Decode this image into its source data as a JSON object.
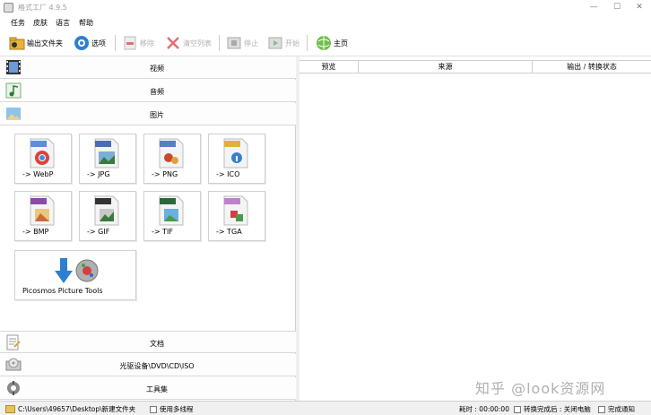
{
  "window": {
    "title": "格式工厂 4.9.5",
    "minimize": "—",
    "maximize": "☐",
    "close": "✕"
  },
  "menu": [
    "任务",
    "皮肤",
    "语言",
    "帮助"
  ],
  "toolbar": {
    "output_folder": "输出文件夹",
    "options": "选项",
    "remove": "移除",
    "clear_list": "清空列表",
    "stop": "停止",
    "start": "开始",
    "home": "主页"
  },
  "categories": {
    "video": "视频",
    "audio": "音频",
    "picture": "图片",
    "document": "文档",
    "optical": "光驱设备\\DVD\\CD\\ISO",
    "tools": "工具集"
  },
  "tiles": [
    {
      "badge": "WebP",
      "label": "-> WebP",
      "color": "#5b8fd6"
    },
    {
      "badge": "JPG",
      "label": "-> JPG",
      "color": "#4a6fb0"
    },
    {
      "badge": "PNG",
      "label": "-> PNG",
      "color": "#5a7fc0"
    },
    {
      "badge": "ICO",
      "label": "-> ICO",
      "color": "#e0b040"
    },
    {
      "badge": "BMP",
      "label": "-> BMP",
      "color": "#8a4aa8"
    },
    {
      "badge": "GIF",
      "label": "-> GIF",
      "color": "#333333"
    },
    {
      "badge": "TIFF",
      "label": "-> TIF",
      "color": "#2a6a3a"
    },
    {
      "badge": "TGA",
      "label": "-> TGA",
      "color": "#c080d0"
    }
  ],
  "picosmos": {
    "label": "Picosmos Picture Tools"
  },
  "grid_headers": [
    "预览",
    "来源",
    "输出 / 转换状态"
  ],
  "watermark": "知乎 @look资源网",
  "status": {
    "path": "C:\\Users\\49657\\Desktop\\新建文件夹",
    "multithread": "使用多线程",
    "elapsed": "耗时 : 00:00:00",
    "after_convert": "转换完成后 : 关闭电脑",
    "notify": "完成通知"
  },
  "colors": {
    "accent": "#2f7fd0",
    "border": "#cfcfcf"
  }
}
